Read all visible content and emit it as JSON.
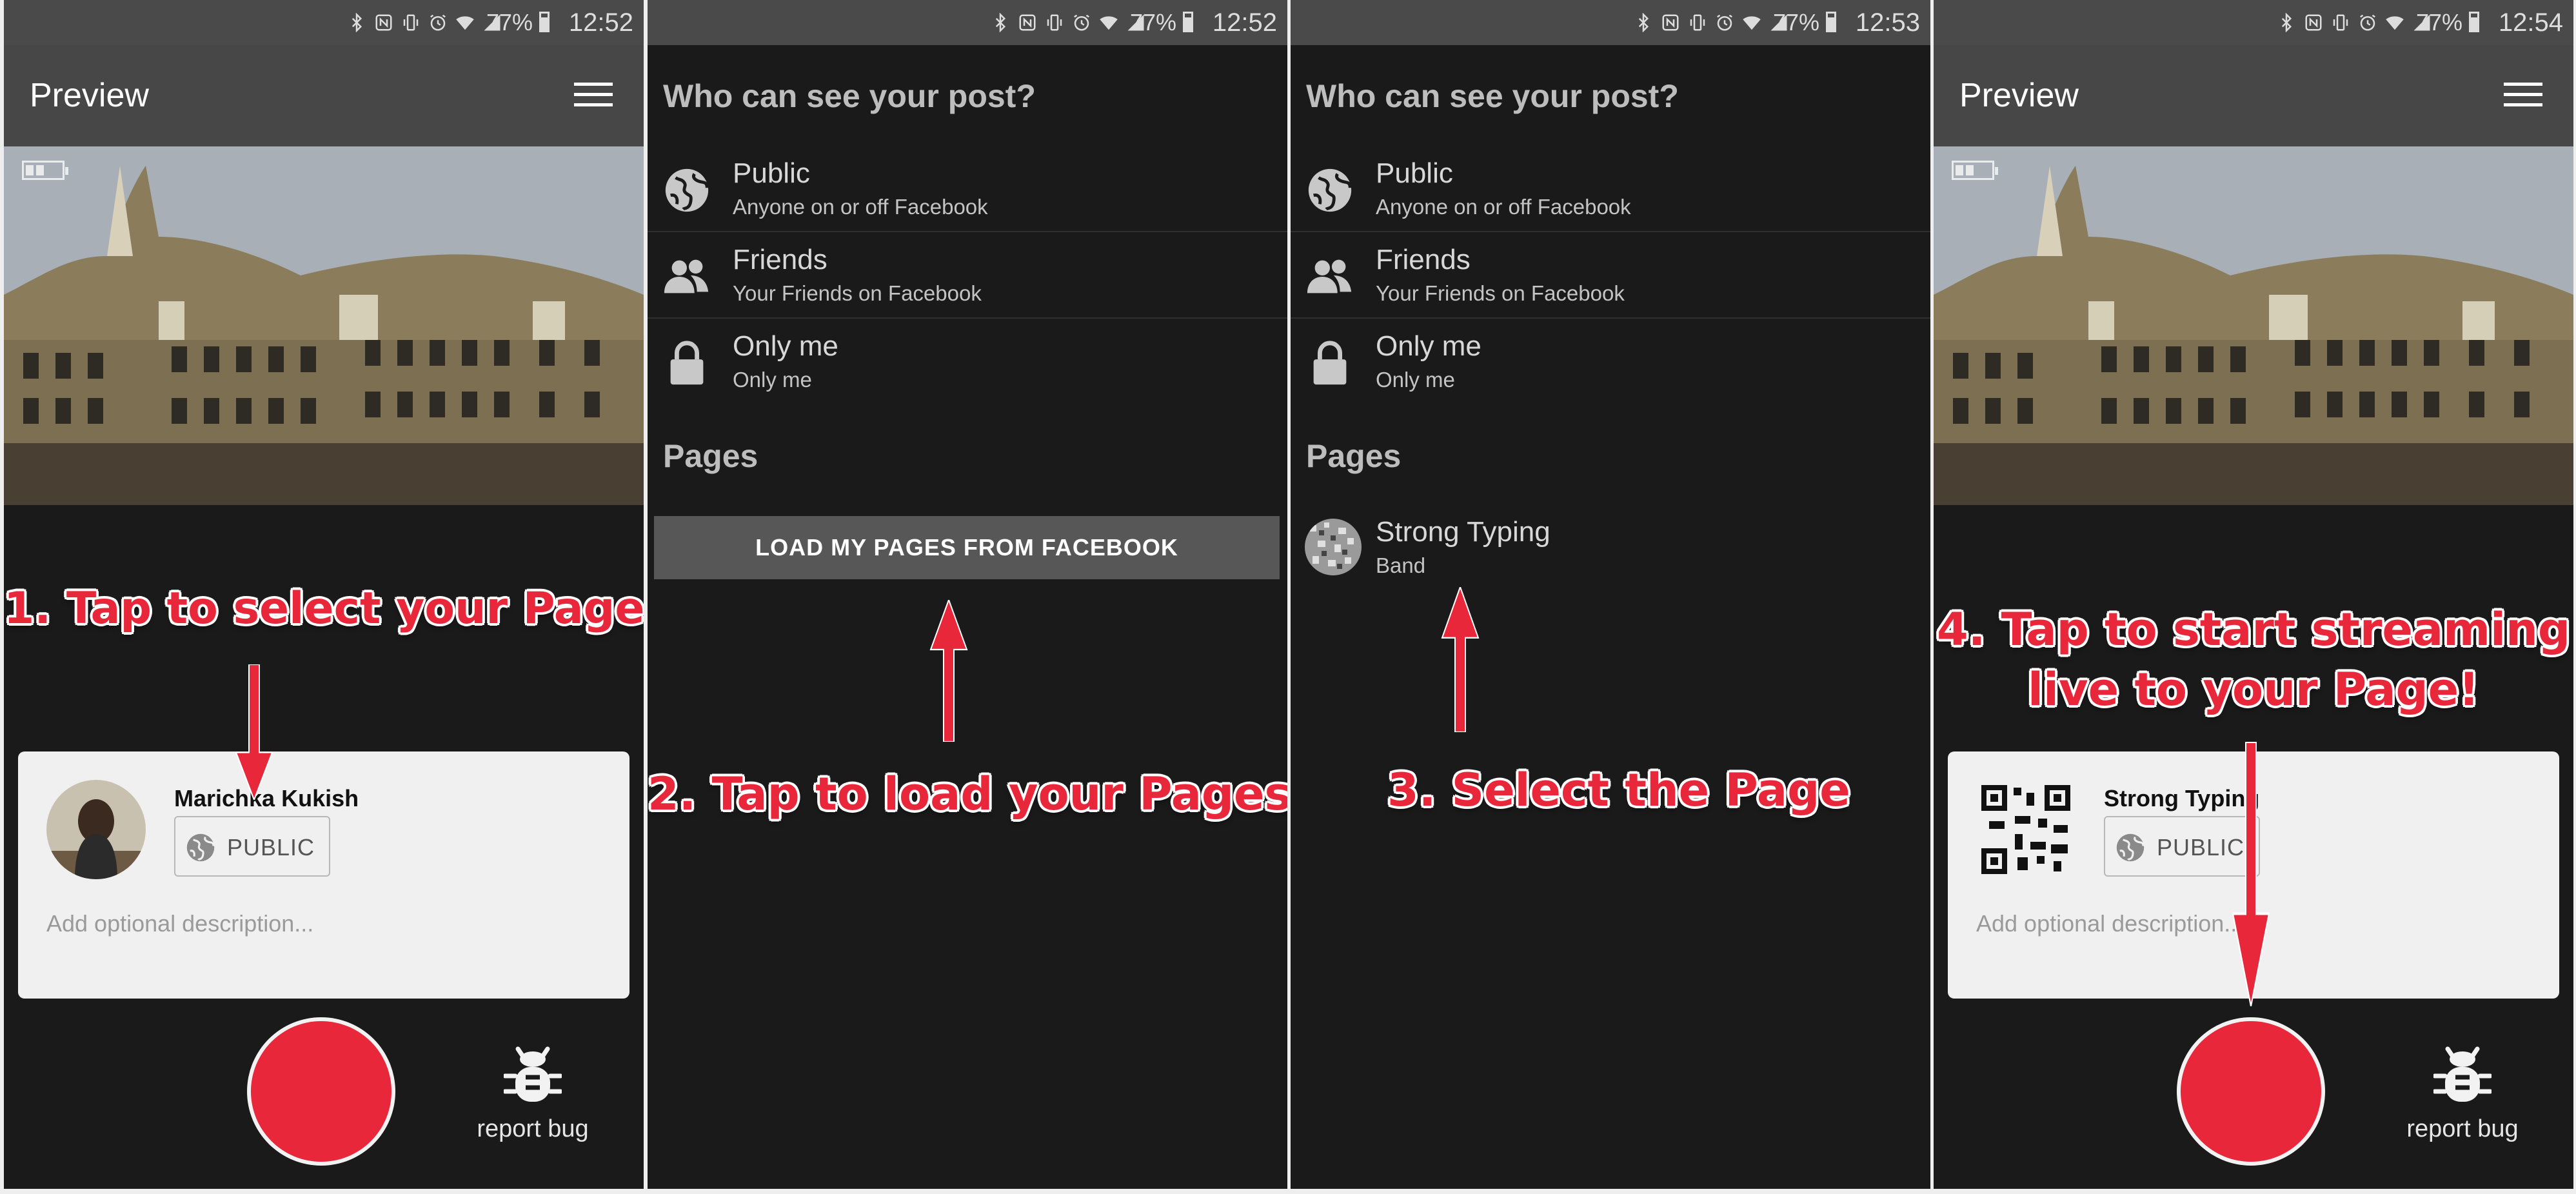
{
  "status_bars": [
    {
      "battery": "77%",
      "time": "12:52"
    },
    {
      "battery": "77%",
      "time": "12:52"
    },
    {
      "battery": "77%",
      "time": "12:53"
    },
    {
      "battery": "77%",
      "time": "12:54"
    }
  ],
  "status_icons": [
    "bluetooth-icon",
    "nfc-icon",
    "vibrate-icon",
    "alarm-icon",
    "wifi-icon",
    "signal-icon"
  ],
  "screen1": {
    "toolbar_title": "Preview",
    "card": {
      "name": "Marichka Kukish",
      "privacy_label": "PUBLIC",
      "description_placeholder": "Add optional description..."
    },
    "report_bug_label": "report bug",
    "annotation": "1. Tap to select your Page"
  },
  "screen2": {
    "heading": "Who can see your post?",
    "options": [
      {
        "label": "Public",
        "sub": "Anyone on or off Facebook",
        "icon": "globe-icon"
      },
      {
        "label": "Friends",
        "sub": "Your Friends on Facebook",
        "icon": "friends-icon"
      },
      {
        "label": "Only me",
        "sub": "Only me",
        "icon": "lock-icon"
      }
    ],
    "pages_heading": "Pages",
    "load_button": "LOAD MY PAGES FROM FACEBOOK",
    "annotation": "2. Tap to load your Pages"
  },
  "screen3": {
    "heading": "Who can see your post?",
    "options": [
      {
        "label": "Public",
        "sub": "Anyone on or off Facebook",
        "icon": "globe-icon"
      },
      {
        "label": "Friends",
        "sub": "Your Friends on Facebook",
        "icon": "friends-icon"
      },
      {
        "label": "Only me",
        "sub": "Only me",
        "icon": "lock-icon"
      }
    ],
    "pages_heading": "Pages",
    "page": {
      "name": "Strong Typing",
      "category": "Band"
    },
    "annotation": "3. Select the Page"
  },
  "screen4": {
    "toolbar_title": "Preview",
    "card": {
      "name": "Strong Typing",
      "privacy_label": "PUBLIC",
      "description_placeholder": "Add optional description..."
    },
    "report_bug_label": "report bug",
    "annotation_line1": "4. Tap to start streaming",
    "annotation_line2": "live to your Page!"
  },
  "colors": {
    "accent": "#e8283a",
    "background": "#1a1a1a",
    "toolbar": "#474747",
    "statusbar": "#4a4a4a",
    "card": "#f0f0f0",
    "button": "#575757"
  }
}
